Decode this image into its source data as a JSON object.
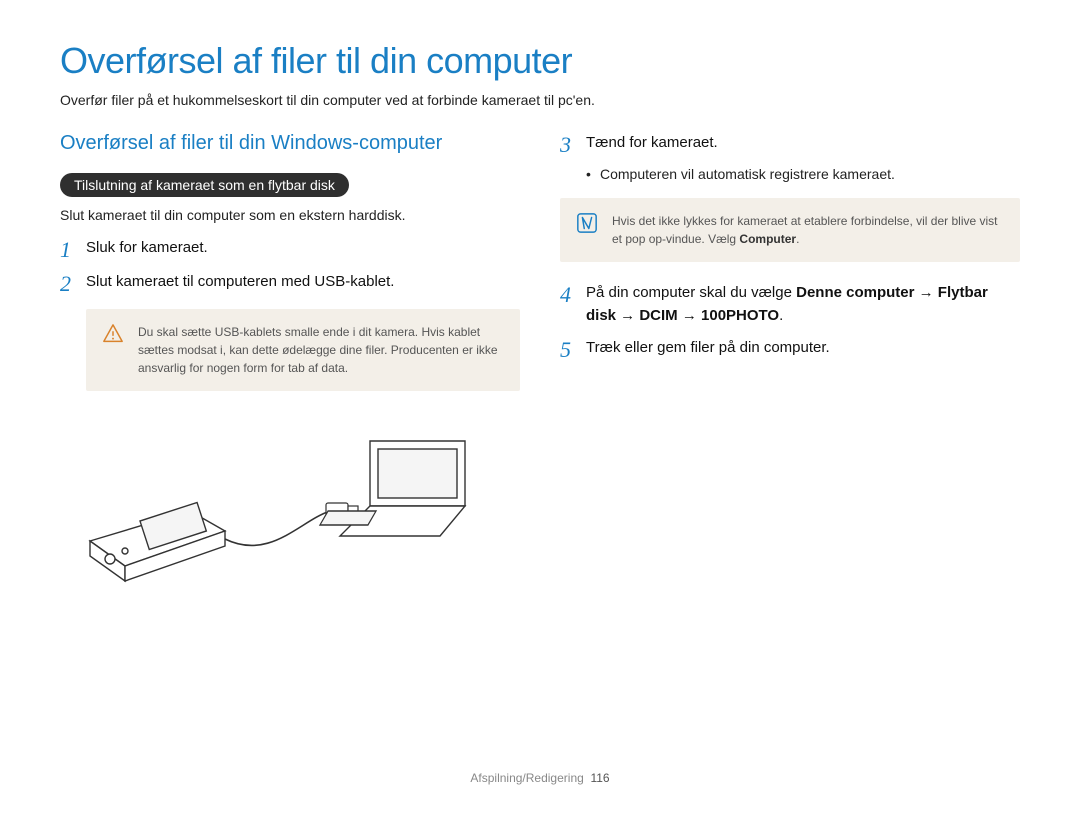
{
  "title": "Overførsel af filer til din computer",
  "intro": "Overfør filer på et hukommelseskort til din computer ved at forbinde kameraet til pc'en.",
  "left": {
    "heading": "Overførsel af filer til din Windows-computer",
    "pill": "Tilslutning af kameraet som en flytbar disk",
    "desc": "Slut kameraet til din computer som en ekstern harddisk.",
    "step1": "Sluk for kameraet.",
    "step2": "Slut kameraet til computeren med USB-kablet.",
    "warning": "Du skal sætte USB-kablets smalle ende i dit kamera. Hvis kablet sættes modsat i, kan dette ødelægge dine filer. Producenten er ikke ansvarlig for nogen form for tab af data."
  },
  "right": {
    "step3": "Tænd for kameraet.",
    "bullet3": "Computeren vil automatisk registrere kameraet.",
    "note_pre": "Hvis det ikke lykkes for kameraet at etablere forbindelse, vil der blive vist et pop op-vindue. Vælg ",
    "note_bold": "Computer",
    "step4_pre": "På din computer skal du vælge ",
    "step4_bold": "Denne computer → Flytbar disk → DCIM → 100PHOTO",
    "step5": "Træk eller gem filer på din computer."
  },
  "footer": {
    "section": "Afspilning/Redigering",
    "page": "116"
  }
}
